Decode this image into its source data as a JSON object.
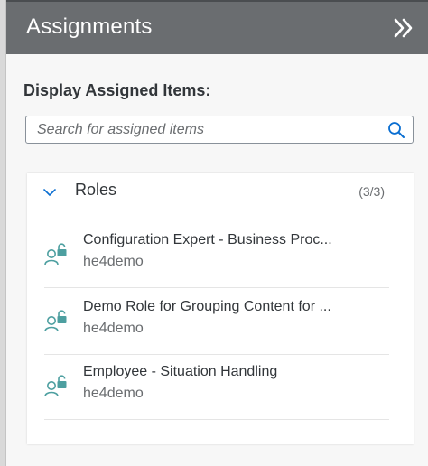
{
  "header": {
    "title": "Assignments",
    "collapse_icon": "double-chevron-right-icon"
  },
  "display_label": "Display Assigned Items:",
  "search": {
    "placeholder": "Search for assigned items",
    "value": "",
    "icon": "search-icon"
  },
  "roles_panel": {
    "title": "Roles",
    "count": "(3/3)",
    "expanded": true,
    "items": [
      {
        "title": "Configuration Expert - Business Proc...",
        "description": "he4demo",
        "icon": "role-user-lock-icon"
      },
      {
        "title": "Demo Role for Grouping Content for ...",
        "description": "he4demo",
        "icon": "role-user-lock-icon"
      },
      {
        "title": "Employee - Situation Handling",
        "description": "he4demo",
        "icon": "role-user-lock-icon"
      }
    ]
  },
  "colors": {
    "header_bg": "#6a6d70",
    "accent": "#0a6ed1",
    "icon_teal": "#4d9fa0",
    "text_primary": "#32363a",
    "text_secondary": "#6a6d70"
  }
}
